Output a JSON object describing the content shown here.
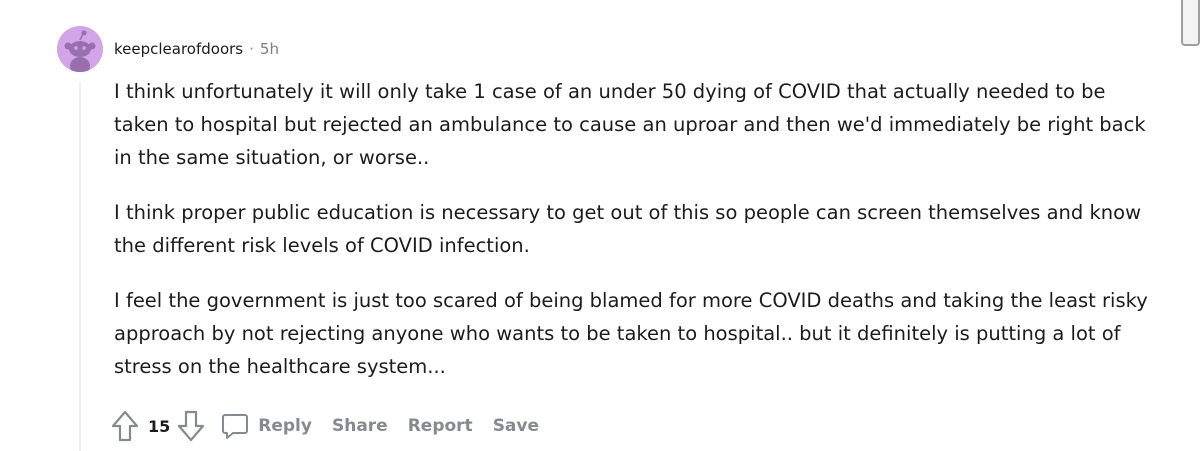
{
  "comment": {
    "author": "keepclearofdoors",
    "separator": "·",
    "timestamp": "5h",
    "avatar_color": "#d4a5e6",
    "paragraphs": [
      "I think unfortunately it will only take 1 case of an under 50 dying of COVID that actually needed to be taken to hospital but rejected an ambulance to cause an uproar and then we'd immediately be right back in the same situation, or worse..",
      "I think proper public education is necessary to get out of this so people can screen themselves and know the different risk levels of COVID infection.",
      "I feel the government is just too scared of being blamed for more COVID deaths and taking the least risky approach by not rejecting anyone who wants to be taken to hospital.. but it definitely is putting a lot of stress on the healthcare system..."
    ],
    "vote_count": "15",
    "actions": {
      "reply": "Reply",
      "share": "Share",
      "report": "Report",
      "save": "Save"
    },
    "icons": {
      "upvote": "upvote-arrow-icon",
      "downvote": "downvote-arrow-icon",
      "comment": "comment-bubble-icon"
    }
  }
}
